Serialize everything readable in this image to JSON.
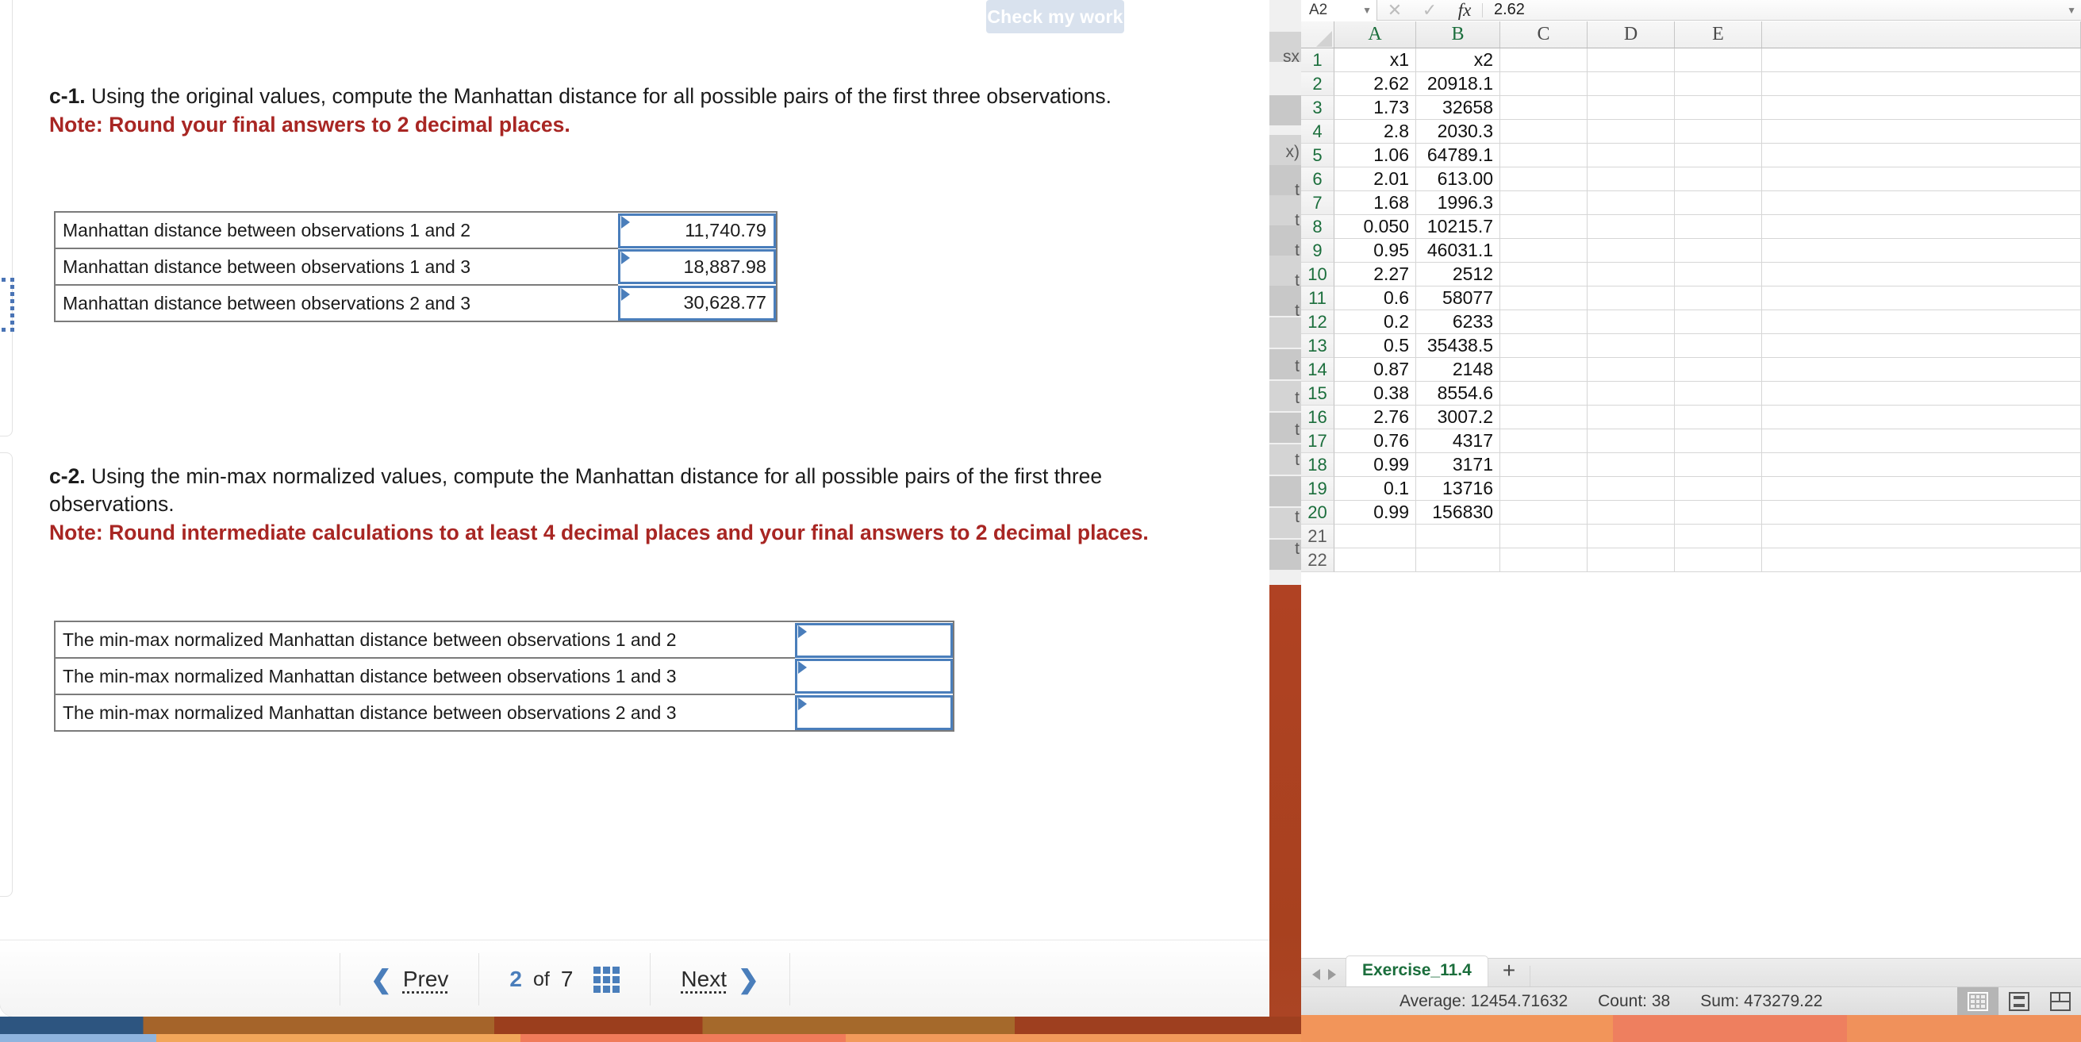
{
  "homework": {
    "check_work_label": "Check my work",
    "questions": [
      {
        "id": "c-1",
        "label": "c-1.",
        "prompt": " Using the original values, compute the Manhattan distance for all possible pairs of the first three observations.",
        "note": "Note: Round your final answers to 2 decimal places.",
        "rows": [
          {
            "label": "Manhattan distance between observations 1 and 2",
            "value": "11,740.79"
          },
          {
            "label": "Manhattan distance between observations 1 and 3",
            "value": "18,887.98"
          },
          {
            "label": "Manhattan distance between observations 2 and 3",
            "value": "30,628.77"
          }
        ]
      },
      {
        "id": "c-2",
        "label": "c-2.",
        "prompt": " Using the min-max normalized values, compute the Manhattan distance for all possible pairs of the first three observations.",
        "note": "Note: Round intermediate calculations to at least 4 decimal places and your final answers to 2 decimal places.",
        "rows": [
          {
            "label": "The min-max normalized Manhattan distance between observations 1 and 2",
            "value": ""
          },
          {
            "label": "The min-max normalized Manhattan distance between observations 1 and 3",
            "value": ""
          },
          {
            "label": "The min-max normalized Manhattan distance between observations 2 and 3",
            "value": ""
          }
        ]
      }
    ],
    "nav": {
      "prev_label": "Prev",
      "next_label": "Next",
      "current_page": "2",
      "of_label": "of",
      "total_pages": "7"
    }
  },
  "sliver": {
    "rows": [
      "sx",
      "x)",
      "t",
      "t",
      "t",
      "t",
      "t",
      "t",
      "t",
      "t",
      "t",
      "t",
      "t"
    ]
  },
  "excel": {
    "formula_bar": {
      "name_box": "A2",
      "cancel_icon": "✕",
      "confirm_icon": "✓",
      "fx_icon": "fx",
      "value": "2.62"
    },
    "columns": [
      "A",
      "B",
      "C",
      "D",
      "E"
    ],
    "selected_columns": [
      "A",
      "B"
    ],
    "row_numbers": [
      1,
      2,
      3,
      4,
      5,
      6,
      7,
      8,
      9,
      10,
      11,
      12,
      13,
      14,
      15,
      16,
      17,
      18,
      19,
      20,
      21,
      22
    ],
    "selected_rows_through": 20,
    "cells": [
      {
        "row": 1,
        "A": "x1",
        "B": "x2"
      },
      {
        "row": 2,
        "A": "2.62",
        "B": "20918.1"
      },
      {
        "row": 3,
        "A": "1.73",
        "B": "32658"
      },
      {
        "row": 4,
        "A": "2.8",
        "B": "2030.3"
      },
      {
        "row": 5,
        "A": "1.06",
        "B": "64789.1"
      },
      {
        "row": 6,
        "A": "2.01",
        "B": "613.00"
      },
      {
        "row": 7,
        "A": "1.68",
        "B": "1996.3"
      },
      {
        "row": 8,
        "A": "0.050",
        "B": "10215.7"
      },
      {
        "row": 9,
        "A": "0.95",
        "B": "46031.1"
      },
      {
        "row": 10,
        "A": "2.27",
        "B": "2512"
      },
      {
        "row": 11,
        "A": "0.6",
        "B": "58077"
      },
      {
        "row": 12,
        "A": "0.2",
        "B": "6233"
      },
      {
        "row": 13,
        "A": "0.5",
        "B": "35438.5"
      },
      {
        "row": 14,
        "A": "0.87",
        "B": "2148"
      },
      {
        "row": 15,
        "A": "0.38",
        "B": "8554.6"
      },
      {
        "row": 16,
        "A": "2.76",
        "B": "3007.2"
      },
      {
        "row": 17,
        "A": "0.76",
        "B": "4317"
      },
      {
        "row": 18,
        "A": "0.99",
        "B": "3171"
      },
      {
        "row": 19,
        "A": "0.1",
        "B": "13716"
      },
      {
        "row": 20,
        "A": "0.99",
        "B": "156830"
      },
      {
        "row": 21,
        "A": "",
        "B": ""
      },
      {
        "row": 22,
        "A": "",
        "B": ""
      }
    ],
    "sheet_tabs": {
      "active_tab": "Exercise_11.4",
      "add_label": "+"
    },
    "status_bar": {
      "average": "Average: 12454.71632",
      "count": "Count: 38",
      "sum": "Sum: 473279.22"
    }
  },
  "colors": {
    "accent_blue": "#4a7ebb",
    "note_red": "#a82623",
    "excel_green": "#1b6e3c"
  }
}
